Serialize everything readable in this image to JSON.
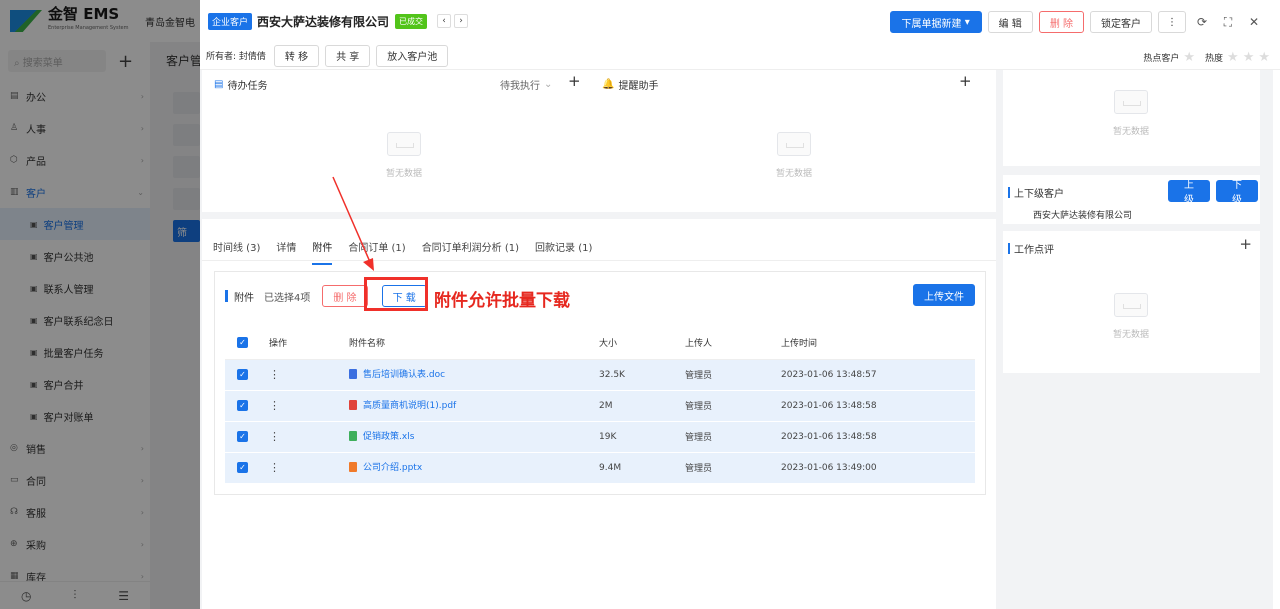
{
  "app": {
    "logo_text": "金智 EMS",
    "logo_sub": "Enterprise Management System",
    "company_short": "青岛金智电",
    "search_placeholder": "搜索菜单",
    "bg_tab": "客户管",
    "bg_btn": "筛"
  },
  "sidebar": {
    "items": [
      {
        "label": "办公",
        "icon": "briefcase-icon"
      },
      {
        "label": "人事",
        "icon": "person-icon"
      },
      {
        "label": "产品",
        "icon": "box-icon"
      },
      {
        "label": "客户",
        "icon": "customer-icon"
      }
    ],
    "sub_items": [
      {
        "label": "客户管理",
        "active": true
      },
      {
        "label": "客户公共池",
        "active": false
      },
      {
        "label": "联系人管理",
        "active": false
      },
      {
        "label": "客户联系纪念日",
        "active": false
      },
      {
        "label": "批量客户任务",
        "active": false
      },
      {
        "label": "客户合并",
        "active": false
      },
      {
        "label": "客户对账单",
        "active": false
      }
    ],
    "items2": [
      {
        "label": "销售"
      },
      {
        "label": "合同"
      },
      {
        "label": "客服"
      },
      {
        "label": "采购"
      },
      {
        "label": "库存"
      }
    ]
  },
  "drawer": {
    "type_badge": "企业客户",
    "title": "西安大萨达装修有限公司",
    "status_badge": "已成交",
    "new_doc_btn": "下属单据新建",
    "edit_btn": "编 辑",
    "delete_btn": "删 除",
    "lock_btn": "锁定客户",
    "owner_label": "所有者: 封倩倩",
    "transfer_btn": "转 移",
    "share_btn": "共 享",
    "pool_btn": "放入客户池",
    "hot_customer": "热点客户",
    "heat_label": "热度"
  },
  "tasks": {
    "title": "待办任务",
    "filter": "待我执行",
    "reminder": "提醒助手",
    "empty": "暂无数据"
  },
  "tabs": [
    {
      "label": "时间线 (3)"
    },
    {
      "label": "详情"
    },
    {
      "label": "附件",
      "active": true
    },
    {
      "label": "合同订单 (1)"
    },
    {
      "label": "合同订单利润分析 (1)"
    },
    {
      "label": "回款记录 (1)"
    }
  ],
  "attachments": {
    "title": "附件",
    "selected": "已选择4项",
    "delete_btn": "删 除",
    "download_btn": "下 载",
    "upload_btn": "上传文件",
    "annotation": "附件允许批量下载",
    "headers": [
      "操作",
      "附件名称",
      "大小",
      "上传人",
      "上传时间"
    ],
    "rows": [
      {
        "name": "售后培训确认表.doc",
        "size": "32.5K",
        "uploader": "管理员",
        "time": "2023-01-06 13:48:57",
        "color": "#3b6fe0"
      },
      {
        "name": "高质量商机说明(1).pdf",
        "size": "2M",
        "uploader": "管理员",
        "time": "2023-01-06 13:48:58",
        "color": "#e0433b"
      },
      {
        "name": "促销政策.xls",
        "size": "19K",
        "uploader": "管理员",
        "time": "2023-01-06 13:48:58",
        "color": "#3eaf5c"
      },
      {
        "name": "公司介绍.pptx",
        "size": "9.4M",
        "uploader": "管理员",
        "time": "2023-01-06 13:49:00",
        "color": "#f07a2a"
      }
    ]
  },
  "right": {
    "empty": "暂无数据",
    "parent_title": "上下级客户",
    "up_btn": "上 级",
    "down_btn": "下 级",
    "related_company": "西安大萨达装修有限公司",
    "comment_title": "工作点评"
  }
}
